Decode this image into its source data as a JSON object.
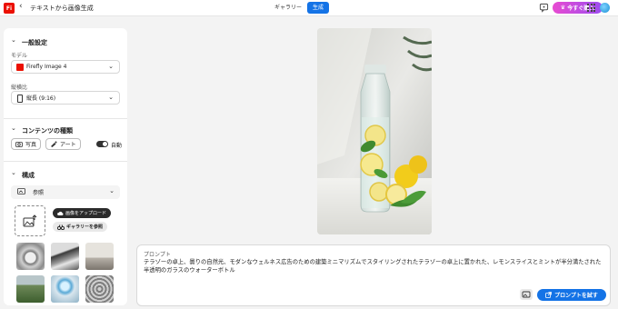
{
  "app": {
    "logo_text": "Fi",
    "back_glyph": "‹",
    "title": "テキストから画像生成"
  },
  "view_switch": {
    "gallery": "ギャラリー",
    "generate": "生成",
    "active": "生成"
  },
  "header_right": {
    "buy_label": "今すぐ購入",
    "crown_glyph": "♛"
  },
  "settings": {
    "general": {
      "title": "一般設定",
      "model_label": "モデル",
      "model_value": "Firefly Image 4",
      "aspect_label": "縦横比",
      "aspect_value": "縦長 (9:16)"
    },
    "content_type": {
      "title": "コンテンツの種類",
      "photo": "写真",
      "art": "アート",
      "auto": "自動",
      "auto_enabled": true
    },
    "composition": {
      "title": "構成",
      "reference_label": "参照",
      "upload_label": "画像をアップロード",
      "gallery_label": "ギャラリーを参照",
      "thumbnails": [
        "thumb-1",
        "thumb-2",
        "thumb-3",
        "thumb-4",
        "thumb-5",
        "thumb-6"
      ]
    }
  },
  "prompt": {
    "label": "プロンプト",
    "text": "テラゾーの卓上、曇りの自然光、モダンなウェルネス広告のための建築ミニマリズムでスタイリングされたテラゾーの卓上に置かれた、レモンスライスとミントが半分満たされた半透明のガラスのウォーターボトル",
    "try_label": "プロンプトを試す"
  },
  "colors": {
    "accent": "#1473e6",
    "brand": "#eb1000",
    "buy_gradient_start": "#e84bd1",
    "buy_gradient_end": "#9b4cf0"
  }
}
